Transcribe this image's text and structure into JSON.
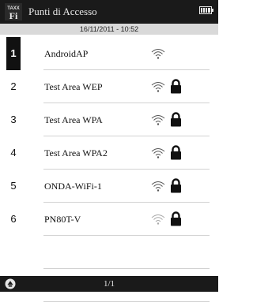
{
  "header": {
    "title": "Punti di Accesso",
    "app_icon": "wifi-app-icon",
    "battery_icon": "battery-icon",
    "datetime": "16/11/2011 - 10:52"
  },
  "networks": [
    {
      "num": "1",
      "name": "AndroidAP",
      "locked": false,
      "selected": true,
      "signal": 1.0
    },
    {
      "num": "2",
      "name": "Test Area WEP",
      "locked": true,
      "selected": false,
      "signal": 1.0
    },
    {
      "num": "3",
      "name": "Test Area WPA",
      "locked": true,
      "selected": false,
      "signal": 1.0
    },
    {
      "num": "4",
      "name": "Test Area WPA2",
      "locked": true,
      "selected": false,
      "signal": 1.0
    },
    {
      "num": "5",
      "name": "ONDA-WiFi-1",
      "locked": true,
      "selected": false,
      "signal": 1.0
    },
    {
      "num": "6",
      "name": "PN80T-V",
      "locked": true,
      "selected": false,
      "signal": 0.5
    }
  ],
  "footer": {
    "nav_icon": "up-arrow-circle-icon",
    "page": "1/1"
  },
  "colors": {
    "titlebar": "#1a1a1a",
    "datebar": "#d9d9d9",
    "signal_strong": "#555555",
    "signal_weak": "#a8a8a8"
  }
}
